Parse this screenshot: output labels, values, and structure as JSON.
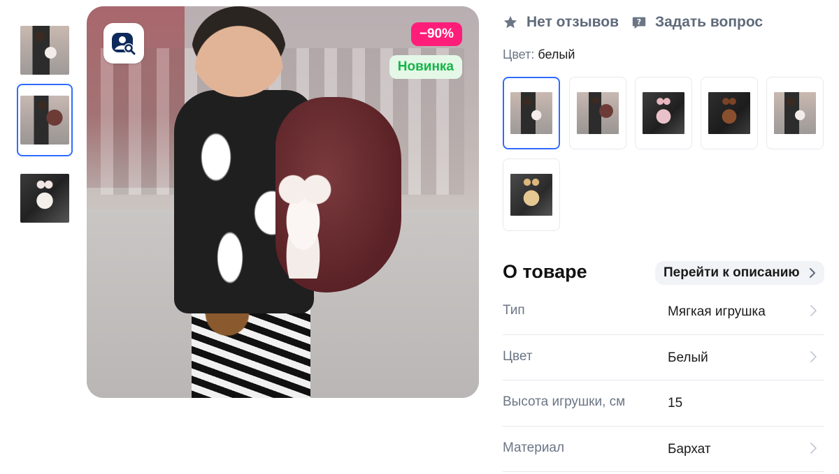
{
  "gallery": {
    "thumbnails": [
      {
        "name": "thumb-1",
        "photo": "kid-photo",
        "active": false
      },
      {
        "name": "thumb-2",
        "photo": "kid-with-bag-photo",
        "active": true
      },
      {
        "name": "thumb-3",
        "photo": "plush-in-car-photo",
        "active": false
      }
    ],
    "badges": {
      "sale": "−90%",
      "new": "Новинка"
    },
    "zoom_icon": "image-search-icon"
  },
  "reviews": {
    "reviews_label": "Нет отзывов",
    "question_label": "Задать вопрос"
  },
  "color": {
    "label": "Цвет:",
    "value": "белый"
  },
  "variants": [
    {
      "name": "variant-white-kid",
      "active": true
    },
    {
      "name": "variant-kid-bag",
      "active": false
    },
    {
      "name": "variant-pink",
      "active": false
    },
    {
      "name": "variant-brown",
      "active": false
    },
    {
      "name": "variant-kid-2",
      "active": false
    },
    {
      "name": "variant-beige",
      "active": false
    }
  ],
  "about": {
    "title": "О товаре",
    "goto_label": "Перейти к описанию",
    "properties": [
      {
        "name": "Тип",
        "value": "Мягкая игрушка",
        "has_link": true
      },
      {
        "name": "Цвет",
        "value": "Белый",
        "has_link": true
      },
      {
        "name": "Высота игрушки, см",
        "value": "15",
        "has_link": false
      },
      {
        "name": "Материал",
        "value": "Бархат",
        "has_link": true
      }
    ]
  },
  "colors": {
    "accent": "#2f6bff",
    "sale_badge": "#ff1d7a",
    "new_badge_text": "#15b447",
    "new_badge_bg": "#e5f8e8",
    "muted_text": "#6b7585"
  }
}
